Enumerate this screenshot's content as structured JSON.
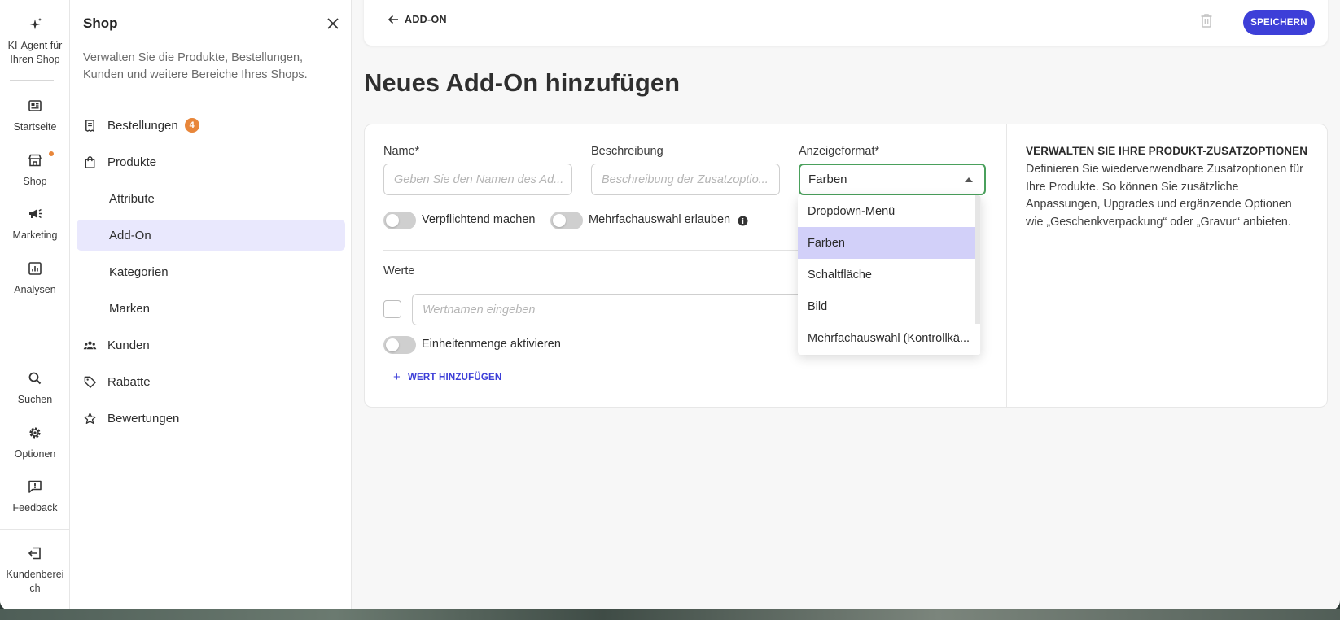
{
  "rail": {
    "ai_agent": "KI-Agent für Ihren Shop",
    "items": [
      {
        "label": "Startseite",
        "icon": "dashboard-icon"
      },
      {
        "label": "Shop",
        "icon": "store-icon"
      },
      {
        "label": "Marketing",
        "icon": "megaphone-icon"
      },
      {
        "label": "Analysen",
        "icon": "chart-icon"
      }
    ],
    "bottom": [
      {
        "label": "Suchen",
        "icon": "search-icon"
      },
      {
        "label": "Optionen",
        "icon": "gear-icon"
      },
      {
        "label": "Feedback",
        "icon": "feedback-icon"
      }
    ],
    "customer_area": "Kundenbereich"
  },
  "panel": {
    "title": "Shop",
    "description": "Verwalten Sie die Produkte, Bestellungen, Kunden und weitere Bereiche Ihres Shops.",
    "nav": {
      "orders": "Bestellungen",
      "orders_badge": "4",
      "products": "Produkte",
      "attributes": "Attribute",
      "addon": "Add-On",
      "categories": "Kategorien",
      "brands": "Marken",
      "customers": "Kunden",
      "discounts": "Rabatte",
      "reviews": "Bewertungen"
    }
  },
  "topbar": {
    "back_label": "ADD-ON",
    "save_label": "SPEICHERN"
  },
  "page": {
    "title": "Neues Add-On hinzufügen"
  },
  "form": {
    "name_label": "Name*",
    "name_placeholder": "Geben Sie den Namen des Ad...",
    "description_label": "Beschreibung",
    "description_placeholder": "Beschreibung der Zusatzoptio...",
    "format_label": "Anzeigeformat*",
    "format_value": "Farben",
    "required_toggle": "Verpflichtend machen",
    "multi_toggle": "Mehrfachauswahl erlauben",
    "values_label": "Werte",
    "value_placeholder": "Wertnamen eingeben",
    "unit_toggle": "Einheitenmenge aktivieren",
    "add_value": "WERT HINZUFÜGEN"
  },
  "dropdown": {
    "options": [
      "Dropdown-Menü",
      "Farben",
      "Schaltfläche",
      "Bild",
      "Mehrfachauswahl (Kontrollkä..."
    ],
    "selected": "Farben"
  },
  "help": {
    "title": "VERWALTEN SIE IHRE PRODUKT-ZUSATZOPTIONEN",
    "text": "Definieren Sie wiederverwendbare Zusatzoptionen für Ihre Produkte. So können Sie zusätzliche Anpassungen, Upgrades und ergänzende Optionen wie „Geschenkverpackung“ oder „Gravur“ anbieten."
  },
  "colors": {
    "accent": "#3d3fd8",
    "active_nav": "#e9e8fd",
    "badge": "#e8863a",
    "select_border": "#4aa05c",
    "selected_option": "#d2d0f9"
  }
}
